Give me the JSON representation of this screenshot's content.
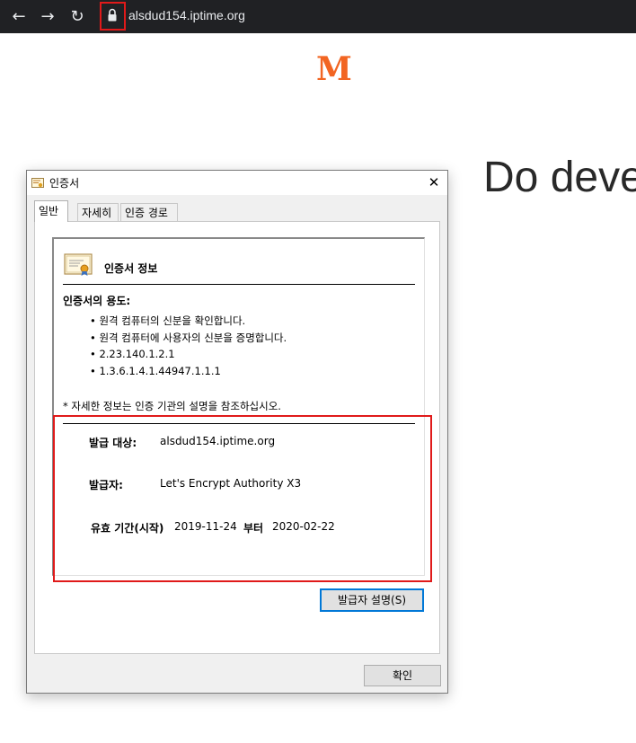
{
  "browser": {
    "url": "alsdud154.iptime.org",
    "back_icon": "←",
    "forward_icon": "→",
    "reload_icon": "↻"
  },
  "page": {
    "logo": "M",
    "headline": "Do deve"
  },
  "dialog": {
    "title": "인증서",
    "close": "✕",
    "tabs": [
      "일반",
      "자세히",
      "인증 경로"
    ],
    "heading": "인증서 정보",
    "purpose_title": "인증서의 용도:",
    "purposes": [
      "원격 컴퓨터의 신분을 확인합니다.",
      "원격 컴퓨터에 사용자의 신분을 증명합니다.",
      "2.23.140.1.2.1",
      "1.3.6.1.4.1.44947.1.1.1"
    ],
    "note": "* 자세한 정보는 인증 기관의 설명을 참조하십시오.",
    "issued_to_label": "발급 대상:",
    "issued_to": "alsdud154.iptime.org",
    "issuer_label": "발급자:",
    "issuer": "Let's Encrypt Authority X3",
    "validity_label": "유효 기간(시작)",
    "valid_from": "2019-11-24",
    "to_label": "부터",
    "valid_to": "2020-02-22",
    "issuer_statement_button": "발급자 설명(S)",
    "ok_button": "확인"
  },
  "colors": {
    "logo": "#f26522",
    "highlight": "#e01a1a",
    "focus": "#0078d7"
  }
}
